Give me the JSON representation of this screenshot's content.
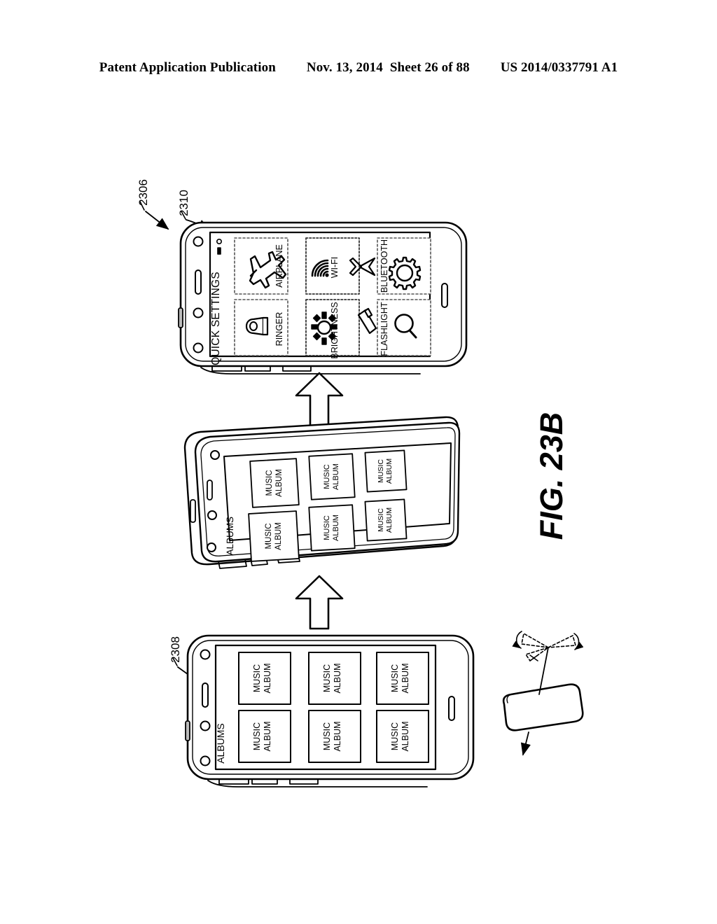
{
  "header": {
    "publication": "Patent Application Publication",
    "date": "Nov. 13, 2014",
    "sheet": "Sheet 26 of 88",
    "number": "US 2014/0337791 A1"
  },
  "figure": {
    "label": "FIG. 23B",
    "reference_numerals": [
      "2306",
      "2310",
      "2308"
    ],
    "overall_ref": "2306"
  },
  "phones": {
    "top": {
      "ref": "2310",
      "screen_title": "QUICK SETTINGS",
      "tiles": [
        {
          "label": "AIRPLANE",
          "icon": "airplane-icon"
        },
        {
          "label": "WI-FI",
          "icon": "wifi-icon"
        },
        {
          "label": "BLUETOOTH",
          "icon": "bluetooth-icon"
        },
        {
          "label": "RINGER",
          "icon": "ringer-bell-icon"
        },
        {
          "label": "BRIGHTNESS",
          "icon": "brightness-sun-icon"
        },
        {
          "label": "FLASHLIGHT",
          "icon": "flashlight-icon"
        }
      ]
    },
    "middle": {
      "ref": "",
      "screen_title": "ALBUMS",
      "tile_line1": "MUSIC",
      "tile_line2": "ALBUM",
      "tile_count": 6
    },
    "bottom": {
      "ref": "2308",
      "screen_title": "ALBUMS",
      "tile_line1": "MUSIC",
      "tile_line2": "ALBUM",
      "tile_count": 6
    }
  },
  "gesture": {
    "name": "tilt-rotate-gesture",
    "description": "device tilt with rotation arcs"
  },
  "colors": {
    "ink": "#000000",
    "paper": "#ffffff",
    "dashed": "#555555"
  }
}
